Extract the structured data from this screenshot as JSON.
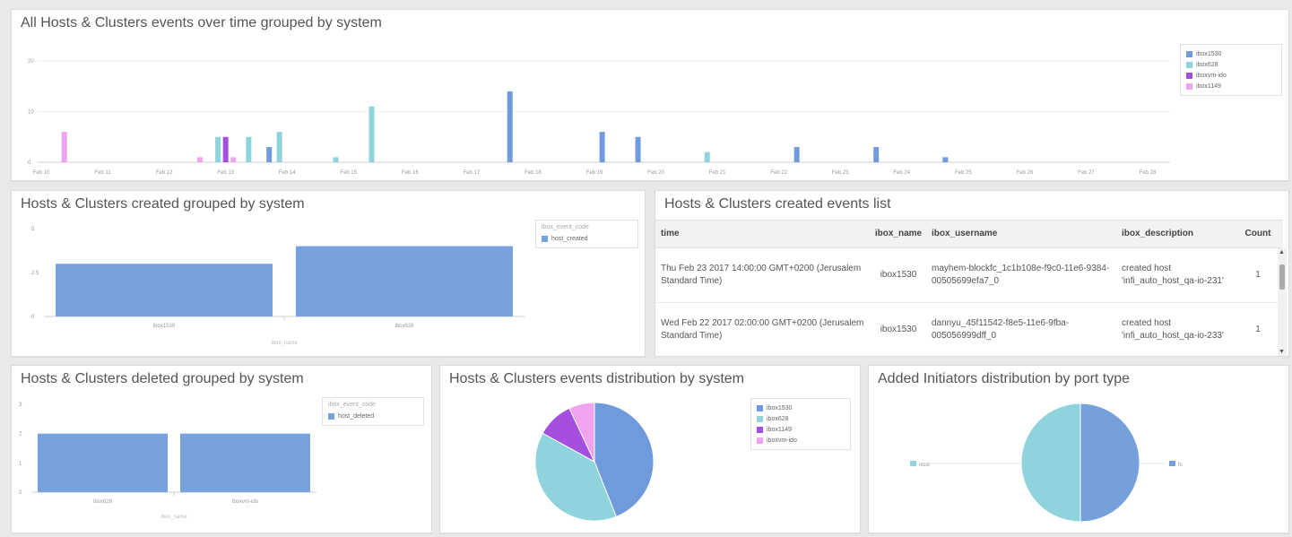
{
  "colors": {
    "ibox1530": "#6f9bdc",
    "ibox628": "#8fd3dc",
    "iboxvm_ido": "#a44fe0",
    "ibox1149": "#f0a4f0",
    "created": "#78a2dd",
    "hostpie_blue": "#76a0dc",
    "hostpie_cyan": "#8fd4dc"
  },
  "panel1": {
    "title": "All Hosts & Clusters events over time grouped by system",
    "legend": [
      {
        "label": "ibox1530",
        "color": "#6f9bdc"
      },
      {
        "label": "ibox628",
        "color": "#8fd3dc"
      },
      {
        "label": "iboxvm-ido",
        "color": "#a44fe0"
      },
      {
        "label": "ibox1149",
        "color": "#f0a4f0"
      }
    ]
  },
  "panel2": {
    "title": "Hosts & Clusters created grouped by system",
    "legend_title": "ibox_event_code",
    "legend": [
      {
        "label": "host_created",
        "color": "#78a2dd"
      }
    ]
  },
  "panel3": {
    "title": "Hosts & Clusters created events list",
    "columns": [
      "time",
      "ibox_name",
      "ibox_username",
      "ibox_description",
      "Count"
    ],
    "rows": [
      {
        "time": "Thu Feb 23 2017 14:00:00 GMT+0200 (Jerusalem Standard Time)",
        "ibox_name": "ibox1530",
        "ibox_username": "mayhem-blockfc_1c1b108e-f9c0-11e6-9384-00505699efa7_0",
        "ibox_description": "created host 'infi_auto_host_qa-io-231'",
        "count": "1"
      },
      {
        "time": "Wed Feb 22 2017 02:00:00 GMT+0200 (Jerusalem Standard Time)",
        "ibox_name": "ibox1530",
        "ibox_username": "dannyu_45f11542-f8e5-11e6-9fba-005056999dff_0",
        "ibox_description": "created host 'infi_auto_host_qa-io-233'",
        "count": "1"
      }
    ]
  },
  "panel4": {
    "title": "Hosts & Clusters deleted grouped by system",
    "legend_title": "ibox_event_code",
    "legend": [
      {
        "label": "host_deleted",
        "color": "#78a2dd"
      }
    ]
  },
  "panel5": {
    "title": "Hosts & Clusters events distribution by system",
    "legend": [
      {
        "label": "ibox1530",
        "color": "#6f9bdc"
      },
      {
        "label": "ibox628",
        "color": "#8fd3dc"
      },
      {
        "label": "ibox1149",
        "color": "#a44fe0"
      },
      {
        "label": "iboxvm-ido",
        "color": "#f0a4f0"
      }
    ]
  },
  "panel6": {
    "title": "Added Initiators distribution by port type",
    "legend": [
      {
        "label": "iscsi",
        "color": "#8fd4dc"
      },
      {
        "label": "fc",
        "color": "#76a0dc"
      }
    ]
  },
  "chart_data": [
    {
      "type": "bar",
      "title": "All Hosts & Clusters events over time grouped by system",
      "categories": [
        "Feb 10",
        "Feb 11",
        "Feb 12",
        "Feb 13",
        "Feb 14",
        "Feb 15",
        "Feb 16",
        "Feb 17",
        "Feb 18",
        "Feb 19",
        "Feb 20",
        "Feb 21",
        "Feb 22",
        "Feb 23",
        "Feb 24",
        "Feb 25",
        "Feb 26",
        "Feb 27",
        "Feb 28"
      ],
      "yticks": [
        "0",
        "10",
        "20"
      ],
      "ylim": [
        0,
        20
      ],
      "x_start": "2017-02-10",
      "series": [
        {
          "name": "ibox1530",
          "bars": [
            {
              "date": "2017-02-13T17:00",
              "value": 3
            },
            {
              "date": "2017-02-17T15:00",
              "value": 14
            },
            {
              "date": "2017-02-19T03:00",
              "value": 6
            },
            {
              "date": "2017-02-19T17:00",
              "value": 5
            },
            {
              "date": "2017-02-22T07:00",
              "value": 3
            },
            {
              "date": "2017-02-23T14:00",
              "value": 3
            },
            {
              "date": "2017-02-24T17:00",
              "value": 1
            }
          ]
        },
        {
          "name": "ibox628",
          "bars": [
            {
              "date": "2017-02-12T21:00",
              "value": 5
            },
            {
              "date": "2017-02-13T09:00",
              "value": 5
            },
            {
              "date": "2017-02-13T21:00",
              "value": 6
            },
            {
              "date": "2017-02-14T19:00",
              "value": 1
            },
            {
              "date": "2017-02-15T09:00",
              "value": 11
            },
            {
              "date": "2017-02-20T20:00",
              "value": 2
            }
          ]
        },
        {
          "name": "iboxvm-ido",
          "bars": [
            {
              "date": "2017-02-13T00:00",
              "value": 5
            }
          ]
        },
        {
          "name": "ibox1149",
          "bars": [
            {
              "date": "2017-02-10T09:00",
              "value": 6
            },
            {
              "date": "2017-02-12T14:00",
              "value": 1
            },
            {
              "date": "2017-02-13T03:00",
              "value": 1
            }
          ]
        }
      ]
    },
    {
      "type": "bar",
      "title": "Hosts & Clusters created grouped by system",
      "categories": [
        "ibox1530",
        "ibox628"
      ],
      "series": [
        {
          "name": "host_created",
          "values": [
            3,
            4
          ]
        }
      ],
      "xlabel": "ibox_name",
      "yticks": [
        "0",
        "2.5",
        "5"
      ],
      "ylim": [
        0,
        5
      ]
    },
    {
      "type": "bar",
      "title": "Hosts & Clusters deleted grouped by system",
      "categories": [
        "ibox628",
        "iboxvm-ido"
      ],
      "series": [
        {
          "name": "host_deleted",
          "values": [
            2,
            2
          ]
        }
      ],
      "xlabel": "ibox_name",
      "yticks": [
        "0",
        "1",
        "2",
        "3"
      ],
      "ylim": [
        0,
        3
      ]
    },
    {
      "type": "pie",
      "title": "Hosts & Clusters events distribution by system",
      "labels": [
        "ibox1530",
        "ibox628",
        "ibox1149",
        "iboxvm-ido"
      ],
      "values": [
        44,
        39,
        10,
        7
      ]
    },
    {
      "type": "pie",
      "title": "Added Initiators distribution by port type",
      "labels": [
        "fc",
        "iscsi"
      ],
      "values": [
        50,
        50
      ]
    }
  ]
}
